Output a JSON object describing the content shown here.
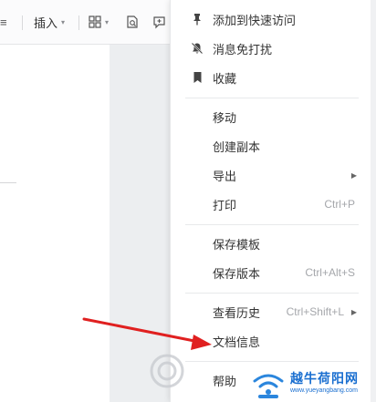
{
  "toolbar": {
    "left_glyph": "≡",
    "insert_label": "插入",
    "caret": "▾"
  },
  "menu": {
    "items": [
      {
        "icon": "pin-icon",
        "label": "添加到快速访问",
        "shortcut": ""
      },
      {
        "icon": "bell-off-icon",
        "label": "消息免打扰",
        "shortcut": ""
      },
      {
        "icon": "bookmark-icon",
        "label": "收藏",
        "shortcut": ""
      },
      {
        "icon": "",
        "label": "移动",
        "shortcut": ""
      },
      {
        "icon": "",
        "label": "创建副本",
        "shortcut": ""
      },
      {
        "icon": "",
        "label": "导出",
        "shortcut": "",
        "submenu": true
      },
      {
        "icon": "",
        "label": "打印",
        "shortcut": "Ctrl+P"
      },
      {
        "icon": "",
        "label": "保存模板",
        "shortcut": ""
      },
      {
        "icon": "",
        "label": "保存版本",
        "shortcut": "Ctrl+Alt+S"
      },
      {
        "icon": "",
        "label": "查看历史",
        "shortcut": "Ctrl+Shift+L",
        "submenu": true
      },
      {
        "icon": "",
        "label": "文档信息",
        "shortcut": ""
      },
      {
        "icon": "",
        "label": "帮助",
        "shortcut": ""
      }
    ],
    "submenu_glyph": "▶"
  },
  "watermark": {
    "title": "越牛荷阳网",
    "url": "www.yueyangbang.com"
  },
  "colors": {
    "arrow": "#e02020",
    "watermark": "#1a6fd0",
    "menu_bg": "#ffffff"
  }
}
